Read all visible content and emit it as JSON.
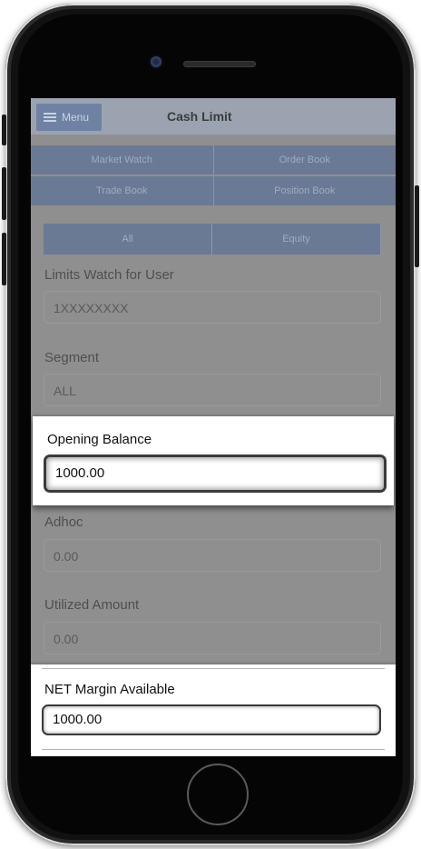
{
  "header": {
    "menu_label": "Menu",
    "title": "Cash Limit"
  },
  "nav": {
    "row1": [
      "Market Watch",
      "Order Book"
    ],
    "row2": [
      "Trade Book",
      "Position Book"
    ]
  },
  "filters": [
    "All",
    "Equity"
  ],
  "form": {
    "limits_watch_label": "Limits Watch for User",
    "limits_watch_value": "1XXXXXXXX",
    "segment_label": "Segment",
    "segment_value": "ALL",
    "opening_balance_label": "Opening Balance",
    "opening_balance_value": "1000.00",
    "adhoc_label": "Adhoc",
    "adhoc_value": "0.00",
    "utilized_label": "Utilized Amount",
    "utilized_value": "0.00",
    "net_margin_label": "NET Margin Available",
    "net_margin_value": "1000.00"
  }
}
